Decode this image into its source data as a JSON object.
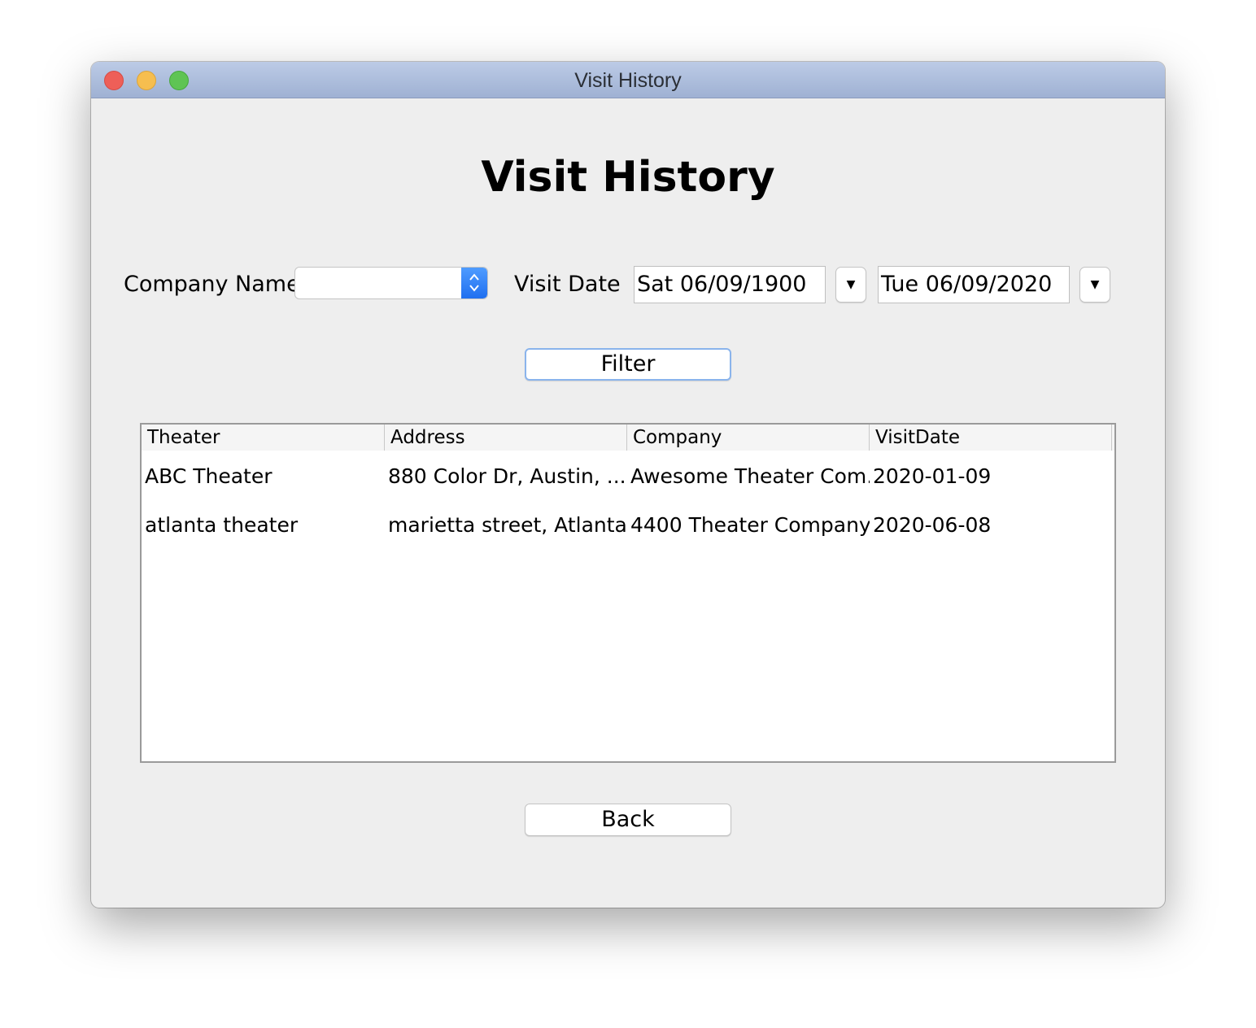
{
  "window": {
    "title": "Visit History"
  },
  "page": {
    "heading": "Visit History"
  },
  "filters": {
    "company_label": "Company Name",
    "company_value": "",
    "visit_date_label": "Visit Date",
    "date_from": "Sat 06/09/1900",
    "date_to": "Tue 06/09/2020",
    "filter_label": "Filter"
  },
  "table": {
    "columns": [
      "Theater",
      "Address",
      "Company",
      "VisitDate"
    ],
    "rows": [
      [
        "ABC Theater",
        "880 Color Dr, Austin, ...",
        "Awesome Theater Com...",
        "2020-01-09"
      ],
      [
        "atlanta theater",
        "marietta street, Atlanta...",
        "4400 Theater Company",
        "2020-06-08"
      ]
    ]
  },
  "footer": {
    "back_label": "Back"
  },
  "icons": {
    "combo_arrows": "up-down-chevron-icon",
    "date_dropdown": "triangle-down-icon"
  },
  "colors": {
    "titlebar": "#aebfdf",
    "combo_accent": "#2a7bf6",
    "focus_ring": "#8ab4ec",
    "window_bg": "#eeeeee"
  }
}
